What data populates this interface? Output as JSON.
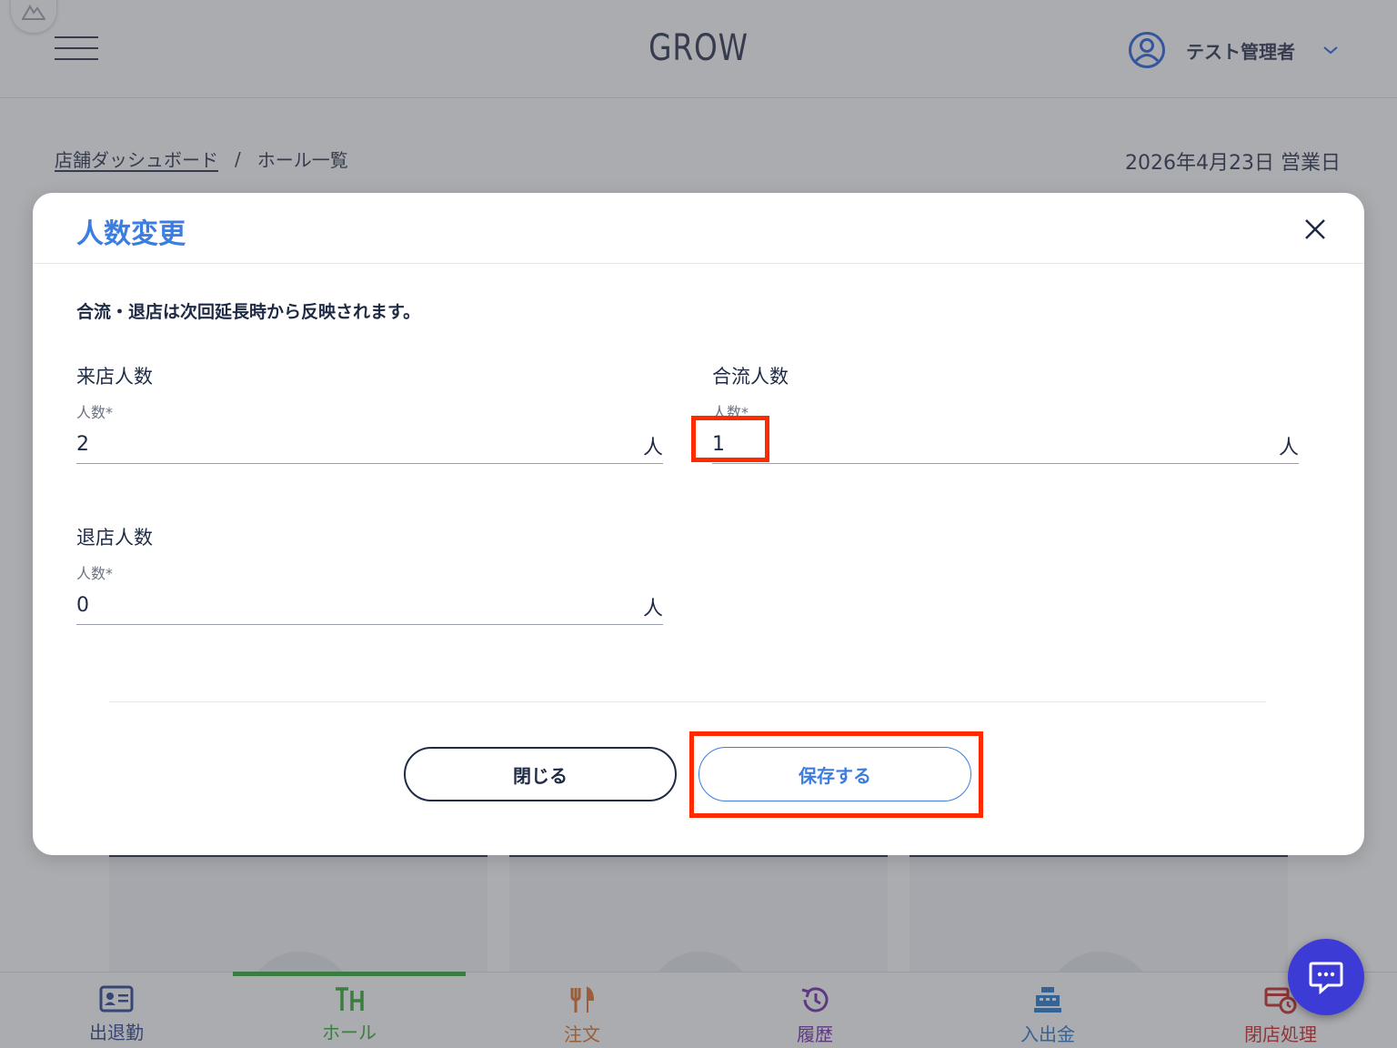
{
  "header": {
    "app_title": "GROW",
    "user_name": "テスト管理者"
  },
  "breadcrumb": {
    "parent": "店舗ダッシュボード",
    "separator": "/",
    "current": "ホール一覧"
  },
  "business_date": "2026年4月23日 営業日",
  "modal": {
    "title": "人数変更",
    "notice": "合流・退店は次回延長時から反映されます。",
    "fields": [
      {
        "title": "来店人数",
        "label": "人数*",
        "value": "2",
        "unit": "人"
      },
      {
        "title": "合流人数",
        "label": "人数*",
        "value": "1",
        "unit": "人"
      },
      {
        "title": "退店人数",
        "label": "人数*",
        "value": "0",
        "unit": "人"
      }
    ],
    "close_label": "閉じる",
    "save_label": "保存する"
  },
  "bottom_nav": [
    {
      "label": "出退勤",
      "icon": "id-card-icon",
      "color": "#1f3a8a"
    },
    {
      "label": "ホール",
      "icon": "table-icon",
      "color": "#2aa52a",
      "active": true
    },
    {
      "label": "注文",
      "icon": "fork-knife-icon",
      "color": "#e06a1a"
    },
    {
      "label": "履歴",
      "icon": "history-icon",
      "color": "#6b21a8"
    },
    {
      "label": "入出金",
      "icon": "cash-register-icon",
      "color": "#1e73c8"
    },
    {
      "label": "閉店処理",
      "icon": "close-store-icon",
      "color": "#c81e1e"
    }
  ],
  "colors": {
    "accent": "#3b7de0",
    "highlight": "#ff2a00",
    "fab": "#3d3bd6"
  }
}
